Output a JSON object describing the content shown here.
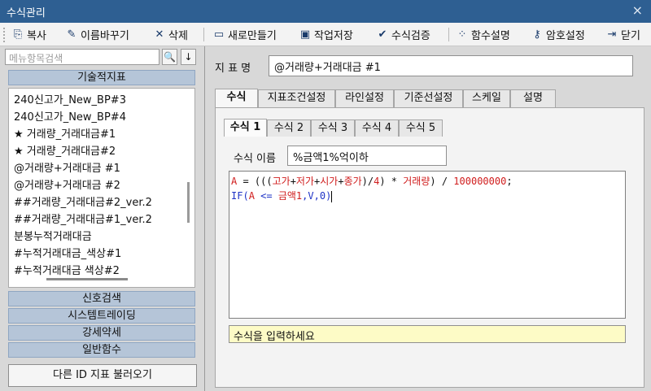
{
  "window": {
    "title": "수식관리",
    "close": "×"
  },
  "toolbar": {
    "items": [
      {
        "icon": "⎘",
        "label": "복사"
      },
      {
        "icon": "✎",
        "label": "이름바꾸기"
      },
      {
        "icon": "✕",
        "label": "삭제"
      },
      {
        "icon": "▭",
        "label": "새로만들기"
      },
      {
        "icon": "▣",
        "label": "작업저장"
      },
      {
        "icon": "✔",
        "label": "수식검증"
      },
      {
        "icon": "⁘",
        "label": "함수설명"
      },
      {
        "icon": "⚷",
        "label": "암호설정"
      },
      {
        "icon": "⇥",
        "label": "닫기"
      }
    ]
  },
  "left": {
    "search_placeholder": "메뉴항목검색",
    "search_icon": "🔍",
    "download_icon": "↓",
    "category_header": "기술적지표",
    "list_items": [
      "240신고가_New_BP#3",
      "240신고가_New_BP#4",
      "★ 거래량_거래대금#1",
      "★ 거래량_거래대금#2",
      "@거래량+거래대금 #1",
      "@거래량+거래대금 #2",
      "##거래량_거래대금#2_ver.2",
      "##거래량_거래대금#1_ver.2",
      "분봉누적거래대금",
      "#누적거래대금_색상#1",
      "#누적거래대금 색상#2"
    ],
    "categories": [
      "신호검색",
      "시스템트레이딩",
      "강세약세",
      "일반함수"
    ],
    "load_button": "다른 ID 지표 불러오기"
  },
  "right": {
    "name_label": "지 표 명",
    "name_value": "@거래량+거래대금 #1",
    "tabs": [
      "수식",
      "지표조건설정",
      "라인설정",
      "기준선설정",
      "스케일",
      "설명"
    ],
    "active_tab": "수식",
    "subtabs": [
      "수식 1",
      "수식 2",
      "수식 3",
      "수식 4",
      "수식 5"
    ],
    "active_subtab": "수식 1",
    "formula_name_label": "수식 이름",
    "formula_name_value": "%금액1%억이하",
    "code": {
      "line1": {
        "var": "A",
        "eq": " = (((",
        "t1": "고가",
        "p1": "+",
        "t2": "저가",
        "p2": "+",
        "t3": "시가",
        "p3": "+",
        "t4": "종가",
        "p4": ")/",
        "n1": "4",
        "p5": ") * ",
        "t5": "거래량",
        "p6": ") / ",
        "n2": "100000000",
        "end": ";"
      },
      "line2": {
        "kw": "IF",
        "p1": "(",
        "var": "A",
        "op": " <= ",
        "fn": "금액1",
        "p2": ",",
        "a2": "V",
        "p3": ",",
        "a3": "0",
        "p4": ")"
      }
    },
    "hint": "수식을 입력하세요"
  },
  "colors": {
    "titlebar": "#2e5f92",
    "category": "#b5c5d8",
    "code_var": "#d01c1c",
    "code_keyword": "#1e33c6",
    "hint_bg": "#fdfbc6"
  }
}
